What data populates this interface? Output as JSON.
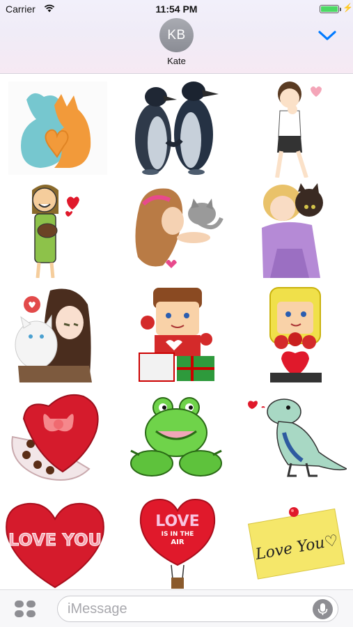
{
  "status_bar": {
    "carrier": "Carrier",
    "time": "11:54 PM",
    "battery_level": 1.0,
    "charging_symbol": "⚡"
  },
  "header": {
    "avatar_initials": "KB",
    "contact_name": "Kate",
    "collapse_icon": "chevron-down-icon"
  },
  "stickers": [
    {
      "name": "cat-and-dog-heart",
      "text": ""
    },
    {
      "name": "penguins-holding-hands",
      "text": ""
    },
    {
      "name": "girl-giggling",
      "text": ""
    },
    {
      "name": "girl-with-puppy",
      "text": ""
    },
    {
      "name": "girl-kissing-kitten",
      "text": ""
    },
    {
      "name": "girl-hugging-kitten",
      "text": ""
    },
    {
      "name": "anime-girl-with-cat",
      "text": ""
    },
    {
      "name": "boy-with-roses-and-gifts",
      "text": ""
    },
    {
      "name": "girl-with-roses-and-heart",
      "text": ""
    },
    {
      "name": "heart-chocolate-box",
      "text": ""
    },
    {
      "name": "green-frog",
      "text": ""
    },
    {
      "name": "dinosaur-with-heart",
      "text": ""
    },
    {
      "name": "love-you-heart",
      "text": "LOVE YOU"
    },
    {
      "name": "love-is-in-the-air-balloon",
      "text_line1": "LOVE",
      "text_line2": "IS IN THE",
      "text_line3": "AIR"
    },
    {
      "name": "love-you-sticky-note",
      "text": "Love You♡"
    }
  ],
  "input": {
    "placeholder": "iMessage",
    "value": ""
  },
  "colors": {
    "accent_blue": "#007aff",
    "battery_green": "#4cd964",
    "heart_red": "#e0192b"
  }
}
